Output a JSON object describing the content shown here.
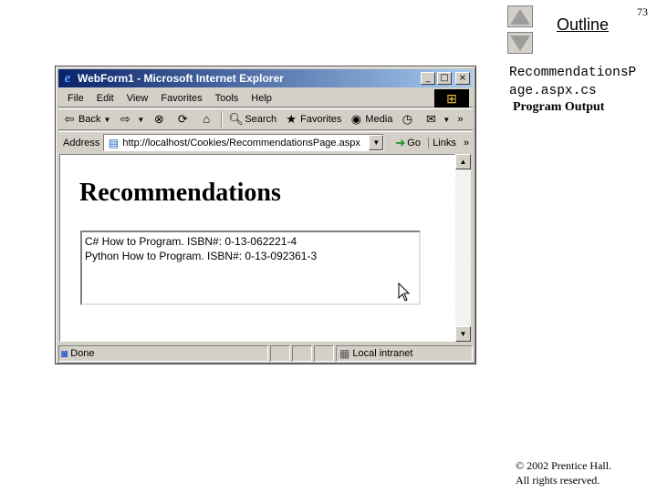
{
  "slide": {
    "page_number": "73",
    "outline_label": "Outline",
    "file_title": "RecommendationsP\nage.aspx.cs",
    "file_subtitle": "Program Output",
    "copyright_line1": "© 2002 Prentice Hall.",
    "copyright_line2": "All rights reserved."
  },
  "window": {
    "title": "WebForm1 - Microsoft Internet Explorer",
    "minimize": "_",
    "maximize": "□",
    "close": "×"
  },
  "menu": {
    "items": [
      "File",
      "Edit",
      "View",
      "Favorites",
      "Tools",
      "Help"
    ]
  },
  "toolbar": {
    "back": "Back",
    "search": "Search",
    "favorites": "Favorites",
    "media": "Media",
    "more": "»"
  },
  "address": {
    "label": "Address",
    "url": "http://localhost/Cookies/RecommendationsPage.aspx",
    "go": "Go",
    "links": "Links"
  },
  "page": {
    "heading": "Recommendations",
    "recommendations": [
      "C# How to Program. ISBN#: 0-13-062221-4",
      "Python How to Program. ISBN#: 0-13-092361-3"
    ]
  },
  "status": {
    "text": "Done",
    "zone": "Local intranet"
  },
  "colors": {
    "titlebar_start": "#0a246a",
    "titlebar_end": "#a6caf0",
    "chrome": "#d4d0c8"
  }
}
